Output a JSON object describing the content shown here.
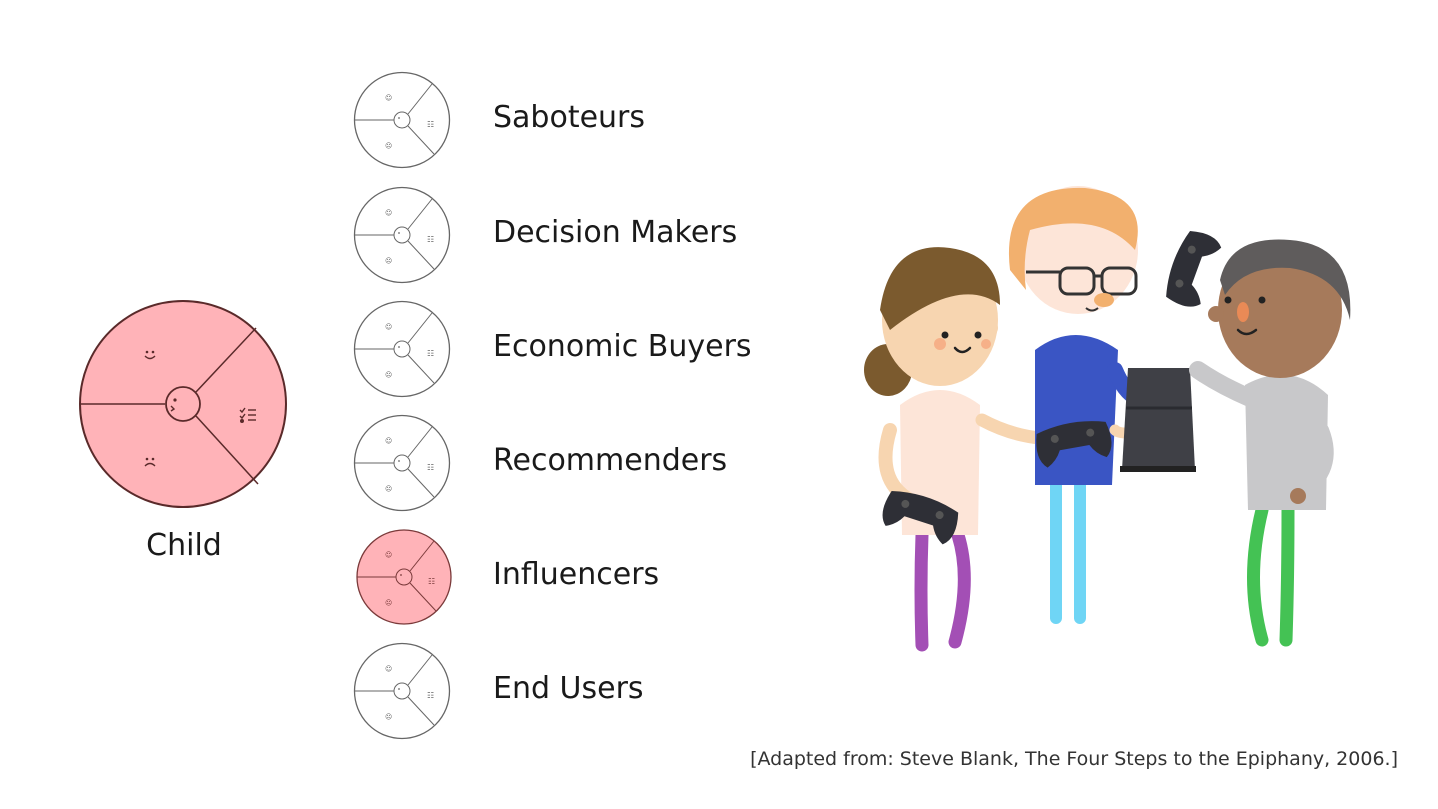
{
  "main_profile": {
    "label": "Child",
    "fill": "#ffb3b8",
    "stroke": "#5a2a2a",
    "icons": [
      "smile-icon",
      "frown-icon",
      "checklist-icon",
      "face-icon"
    ]
  },
  "roles": [
    {
      "label": "Saboteurs",
      "highlighted": false
    },
    {
      "label": "Decision Makers",
      "highlighted": false
    },
    {
      "label": "Economic Buyers",
      "highlighted": false
    },
    {
      "label": "Recommenders",
      "highlighted": false
    },
    {
      "label": "Influencers",
      "highlighted": true
    },
    {
      "label": "End Users",
      "highlighted": false
    }
  ],
  "colors": {
    "highlight_fill": "#ffb3b8",
    "outline": "#555555",
    "text": "#1a1a1a"
  },
  "illustration": {
    "description_icon": "three-people-with-game-controllers-illustration"
  },
  "citation": "[Adapted from: Steve Blank, The Four Steps to the Epiphany, 2006.]"
}
